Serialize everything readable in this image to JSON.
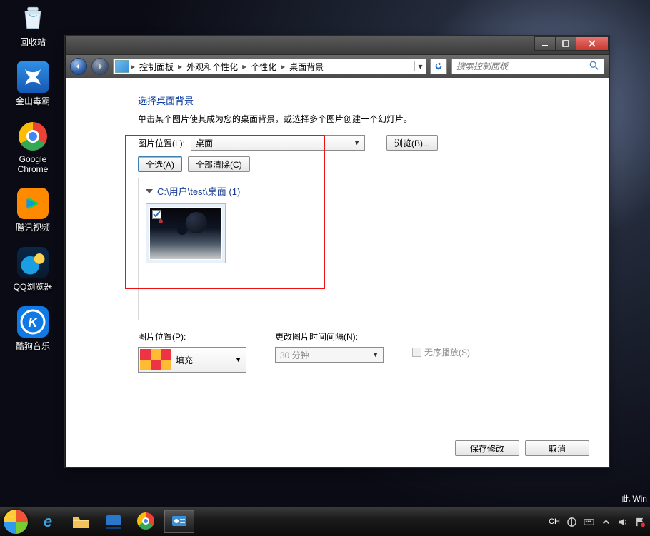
{
  "desktop": {
    "icons": [
      {
        "label": "回收站"
      },
      {
        "label": "金山毒霸"
      },
      {
        "label": "Google\nChrome"
      },
      {
        "label": "腾讯视频"
      },
      {
        "label": "QQ浏览器"
      },
      {
        "label": "酷狗音乐"
      }
    ],
    "watermark": "此 Win"
  },
  "window": {
    "breadcrumb": [
      "控制面板",
      "外观和个性化",
      "个性化",
      "桌面背景"
    ],
    "search_placeholder": "搜索控制面板",
    "title": "选择桌面背景",
    "desc": "单击某个图片使其成为您的桌面背景，或选择多个图片创建一个幻灯片。",
    "picture_location_label": "图片位置(L):",
    "picture_location_value": "桌面",
    "browse_btn": "浏览(B)...",
    "select_all_btn": "全选(A)",
    "clear_all_btn": "全部清除(C)",
    "folder_path": "C:\\用户\\test\\桌面 (1)",
    "position_label": "图片位置(P):",
    "position_value": "填充",
    "interval_label": "更改图片时间间隔(N):",
    "interval_value": "30 分钟",
    "shuffle_label": "无序播放(S)",
    "save_btn": "保存修改",
    "cancel_btn": "取消"
  },
  "tray": {
    "ime": "CH",
    "kb": "⌨"
  }
}
